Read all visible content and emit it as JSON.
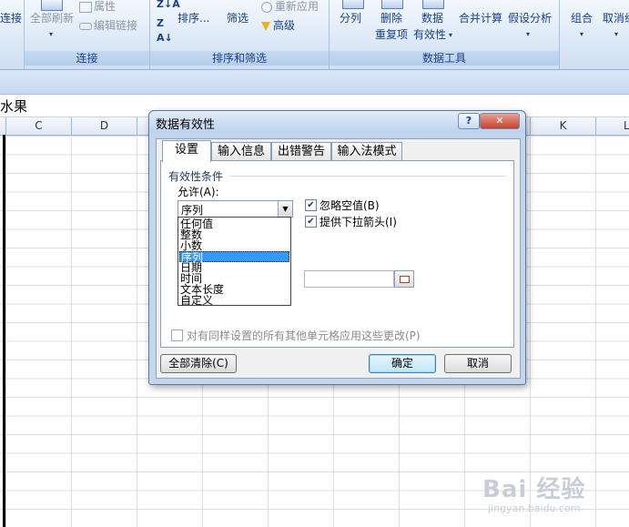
{
  "ribbon": {
    "connections": {
      "partial_left": "连接",
      "refresh_all": "全部刷新",
      "properties": "属性",
      "edit_links": "编辑链接",
      "label": "连接"
    },
    "sort_filter": {
      "sort": "排序...",
      "filter": "筛选",
      "reapply": "重新应用",
      "advanced": "高级",
      "label": "排序和筛选"
    },
    "data_tools": {
      "text_to_columns": "分列",
      "remove_dup_1": "删除",
      "remove_dup_2": "重复项",
      "validation_1": "数据",
      "validation_2": "有效性",
      "consolidate": "合并计算",
      "what_if": "假设分析",
      "label": "数据工具"
    },
    "outline": {
      "group": "组合",
      "ungroup": "取消组"
    }
  },
  "formula_bar": {
    "content": "水果"
  },
  "columns": [
    "C",
    "D",
    "E",
    "F",
    "G",
    "H",
    "I",
    "J",
    "K",
    "L"
  ],
  "dialog": {
    "title": "数据有效性",
    "help": "?",
    "close": "✕",
    "tabs": [
      "设置",
      "输入信息",
      "出错警告",
      "输入法模式"
    ],
    "section_title": "有效性条件",
    "allow_label": "允许(A):",
    "allow_value": "序列",
    "options": [
      "任何值",
      "整数",
      "小数",
      "序列",
      "日期",
      "时间",
      "文本长度",
      "自定义"
    ],
    "selected_index": 3,
    "ignore_blank": "忽略空值(B)",
    "ignore_blank_checked": true,
    "dropdown": "提供下拉箭头(I)",
    "dropdown_checked": true,
    "apply_all": "对有同样设置的所有其他单元格应用这些更改(P)",
    "apply_all_checked": false,
    "clear_all": "全部清除(C)",
    "ok": "确定",
    "cancel": "取消"
  },
  "watermark": {
    "main": "Bai 经验",
    "sub": "jingyan.baidu.com"
  }
}
